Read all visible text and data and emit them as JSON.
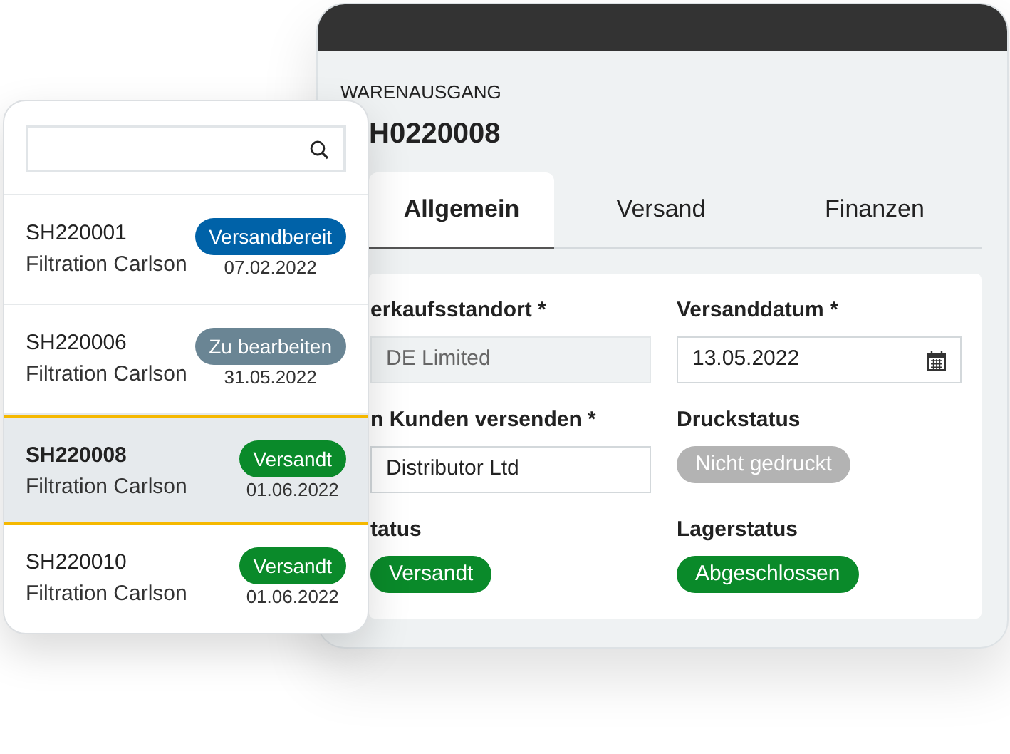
{
  "detail": {
    "section": "WARENAUSGANG",
    "title": "H0220008",
    "tabs": [
      {
        "label": "Allgemein",
        "selected": true
      },
      {
        "label": "Versand",
        "selected": false
      },
      {
        "label": "Finanzen",
        "selected": false
      }
    ],
    "fields": [
      {
        "kind": "input",
        "label": "erkaufsstandort *",
        "value": "DE Limited",
        "disabled": true
      },
      {
        "kind": "date",
        "label": "Versanddatum *",
        "value": "13.05.2022",
        "disabled": false
      },
      {
        "kind": "input",
        "label": "n Kunden versenden *",
        "value": "Distributor Ltd",
        "disabled": false
      },
      {
        "kind": "badge",
        "label": "Druckstatus",
        "value": "Nicht gedruckt",
        "color": "#b3b3b3"
      },
      {
        "kind": "badge",
        "label": "tatus",
        "value": "Versandt",
        "color": "#0a8a2a"
      },
      {
        "kind": "badge",
        "label": "Lagerstatus",
        "value": "Abgeschlossen",
        "color": "#0a8a2a"
      }
    ]
  },
  "list": {
    "items": [
      {
        "id": "SH220001",
        "customer": "Filtration Carlson",
        "status": "Versandbereit",
        "color": "#0062a8",
        "date": "07.02.2022",
        "selected": false
      },
      {
        "id": "SH220006",
        "customer": "Filtration Carlson",
        "status": "Zu bearbeiten",
        "color": "#6a8594",
        "date": "31.05.2022",
        "selected": false
      },
      {
        "id": "SH220008",
        "customer": "Filtration Carlson",
        "status": "Versandt",
        "color": "#0a8a2a",
        "date": "01.06.2022",
        "selected": true
      },
      {
        "id": "SH220010",
        "customer": "Filtration Carlson",
        "status": "Versandt",
        "color": "#0a8a2a",
        "date": "01.06.2022",
        "selected": false
      }
    ]
  }
}
